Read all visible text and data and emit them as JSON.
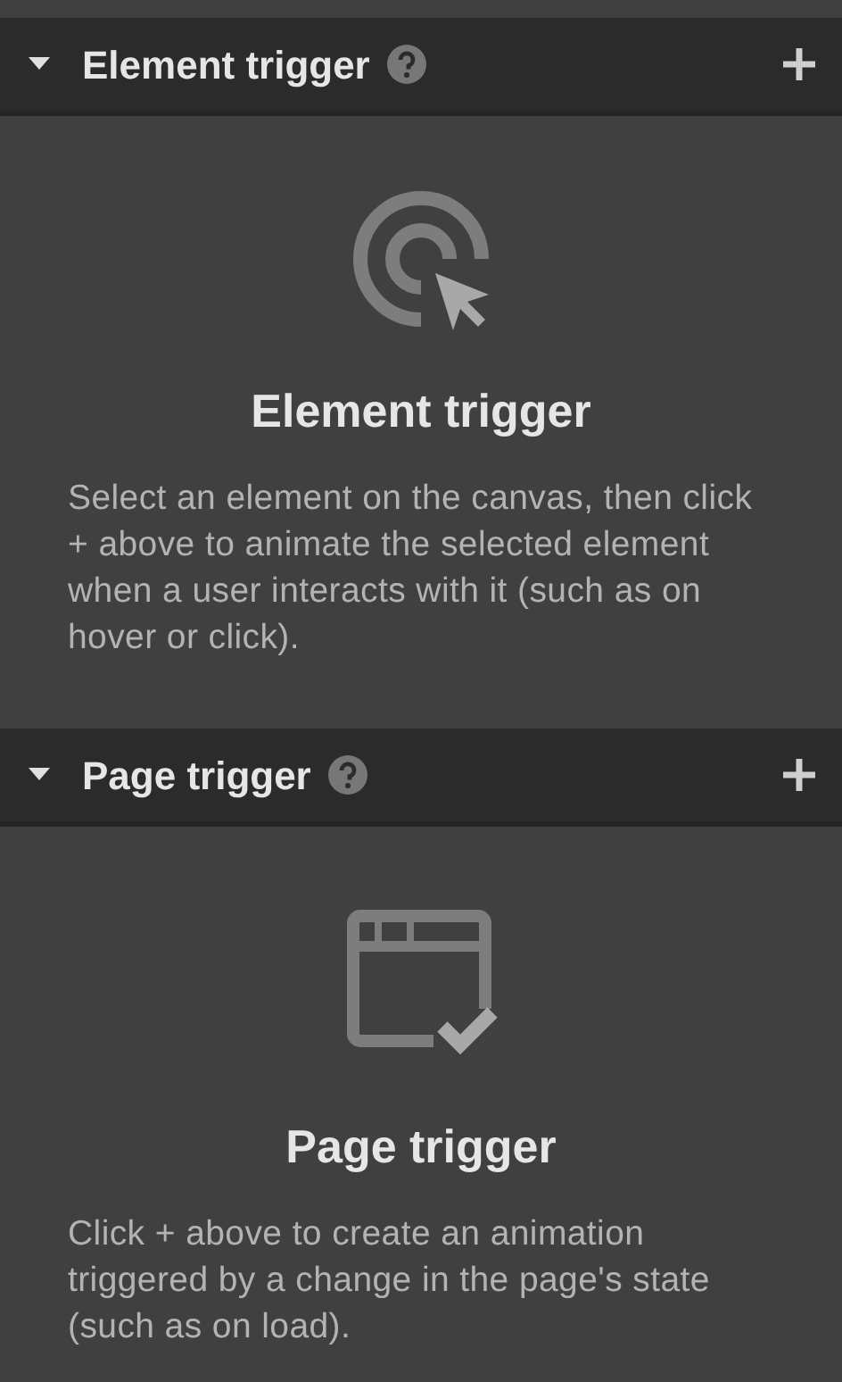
{
  "sections": [
    {
      "kind": "element",
      "title": "Element trigger",
      "expanded": true,
      "empty_state": {
        "title": "Element trigger",
        "description": "Select an element on the canvas, then click + above to animate the selected element when a user interacts with it (such as on hover or click)."
      }
    },
    {
      "kind": "page",
      "title": "Page trigger",
      "expanded": true,
      "empty_state": {
        "title": "Page trigger",
        "description": "Click + above to create an animation triggered by a change in the page's state (such as on load)."
      }
    }
  ]
}
